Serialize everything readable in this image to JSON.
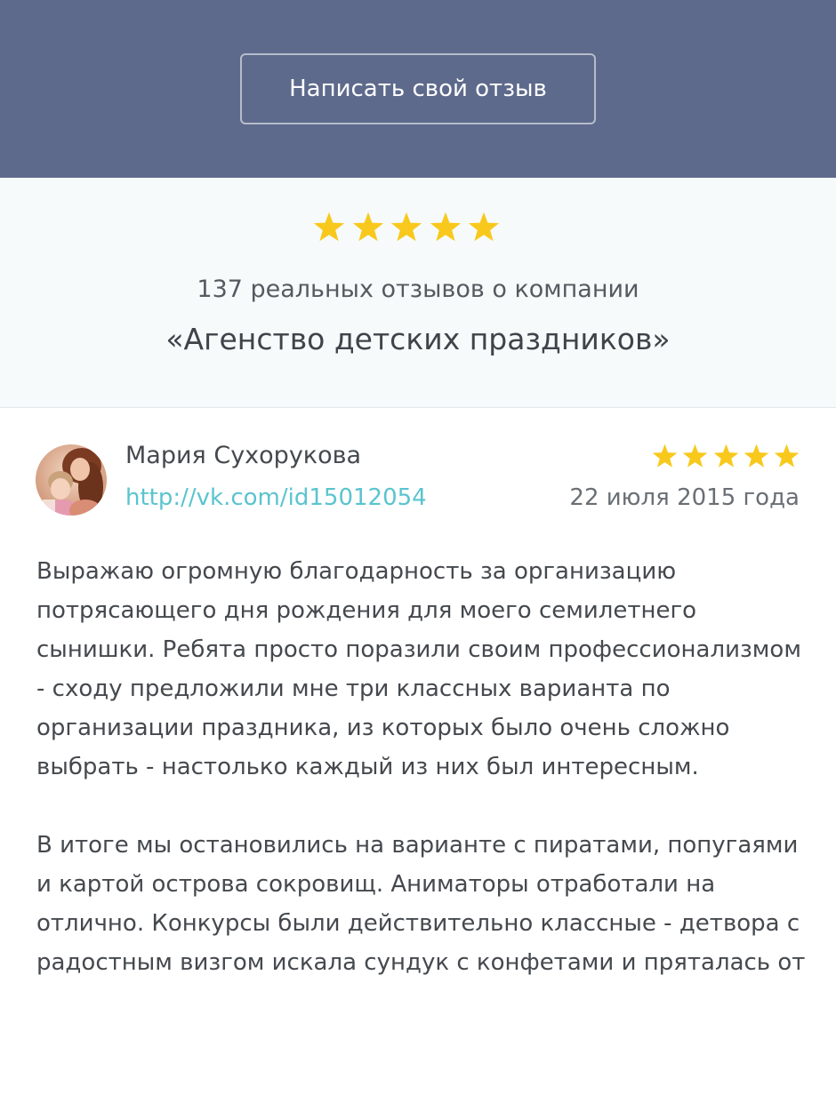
{
  "header": {
    "write_review_label": "Написать свой отзыв"
  },
  "summary": {
    "rating": 5,
    "rating_max": 5,
    "count_text": "137 реальных отзывов о компании",
    "company_name": "«Агенство детских праздников»"
  },
  "review": {
    "author_name": "Мария Сухорукова",
    "author_link": "http://vk.com/id15012054",
    "date": "22 июля 2015 года",
    "rating": 5,
    "rating_max": 5,
    "paragraphs": [
      "Выражаю огромную благодарность за организацию потрясающего дня рождения для моего семилетнего сынишки. Ребята просто поразили своим профессионализмом - сходу предложили мне три классных варианта по организации праздника, из которых было очень сложно выбрать - настолько каждый из них был интересным.",
      "В итоге мы остановились на варианте с пиратами, попугаями и картой острова сокровищ. Аниматоры отработали на отлично. Конкурсы были действительно классные - детвора с радостным визгом искала сундук с конфетами и пряталась от"
    ]
  },
  "colors": {
    "header_bg": "#5e6a8c",
    "summary_bg": "#f6fafa",
    "star": "#f8c91c",
    "link": "#5ac4cf",
    "text": "#45494e"
  },
  "icons": {
    "star": "star-icon",
    "avatar": "avatar-photo"
  }
}
